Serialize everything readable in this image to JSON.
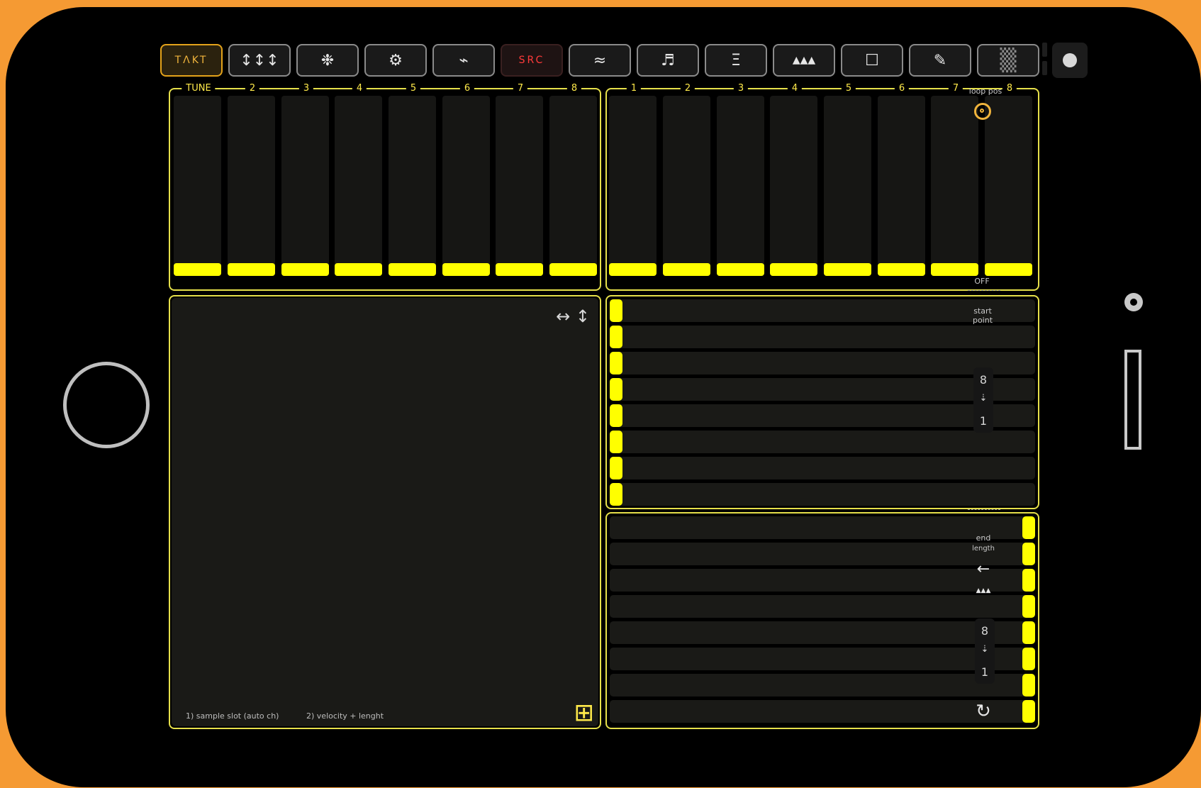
{
  "toolbar": {
    "takt_label": "TΛKT",
    "src_label": "SRC",
    "icons": [
      "↕↕↕",
      "❉",
      "⚙",
      "⌁",
      "≈",
      "♬",
      "Ξ",
      "▲▲▲",
      "☐",
      "✎",
      "▒"
    ]
  },
  "left_faders": {
    "labels": [
      "TUNE",
      "2",
      "3",
      "4",
      "5",
      "6",
      "7",
      "8"
    ]
  },
  "right_faders": {
    "labels": [
      "1",
      "2",
      "3",
      "4",
      "5",
      "6",
      "7",
      "8"
    ]
  },
  "xy_pad": {
    "move_icon": "↔ ↕",
    "caption_1": "1) sample slot (auto ch)",
    "caption_2": "2) velocity + lenght",
    "grid_icon": "⊞"
  },
  "side": {
    "loop_pos": "loop pos",
    "off": "OFF",
    "start_point": "start\npoint",
    "start_top": "8",
    "start_mid": "⇣",
    "start_bottom": "1",
    "end_length_1": "end",
    "end_length_2": "length",
    "arrow": "←",
    "triangles": "▲▲▲",
    "end_top": "8",
    "end_mid": "⇣",
    "end_bottom": "1",
    "loop_icon": "↻"
  }
}
